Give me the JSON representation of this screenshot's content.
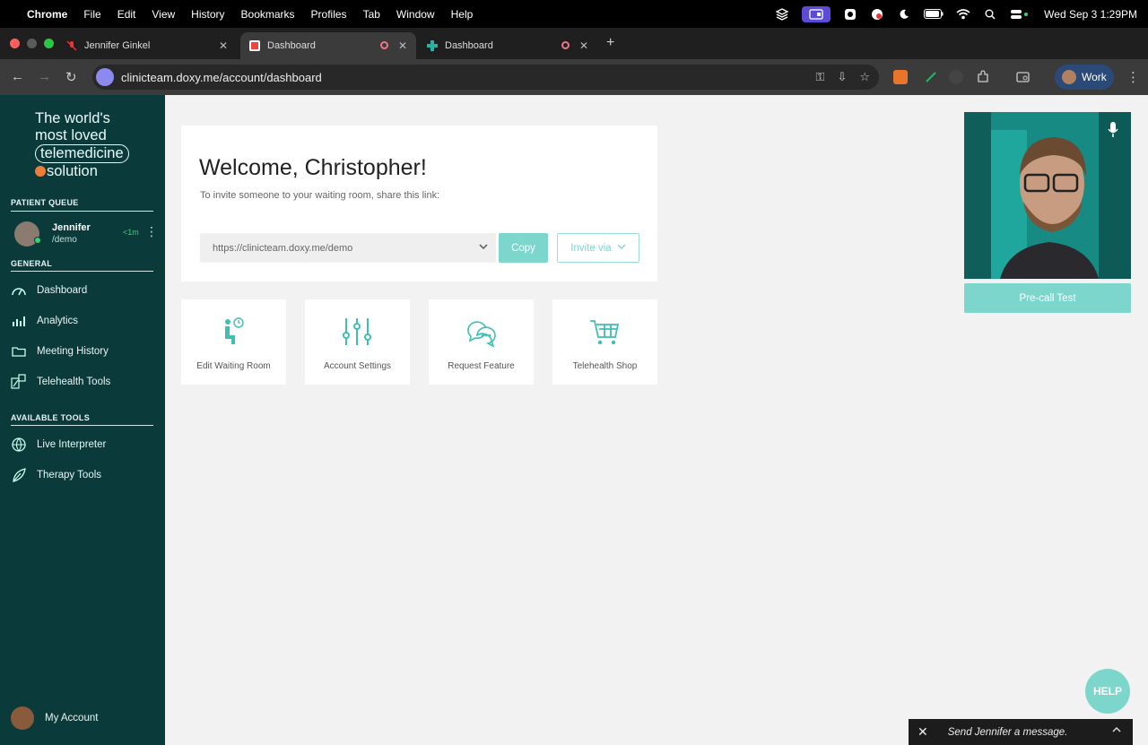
{
  "menubar": {
    "app": "Chrome",
    "items": [
      "File",
      "Edit",
      "View",
      "History",
      "Bookmarks",
      "Profiles",
      "Tab",
      "Window",
      "Help"
    ],
    "clock": "Wed Sep 3  1:29PM"
  },
  "tabs": [
    {
      "title": "Jennifer Ginkel"
    },
    {
      "title": "Dashboard"
    },
    {
      "title": "Dashboard"
    }
  ],
  "toolbar": {
    "url": "clinicteam.doxy.me/account/dashboard",
    "profile_label": "Work"
  },
  "sidebar": {
    "tagline": {
      "line1": "The world's",
      "line2": "most loved",
      "line3": "telemedicine",
      "line4": "solution"
    },
    "patient_queue_label": "PATIENT QUEUE",
    "queue": [
      {
        "name": "Jennifer",
        "room": "/demo",
        "wait": "<1m"
      }
    ],
    "general_label": "GENERAL",
    "general_items": [
      {
        "label": "Dashboard",
        "icon": "gauge-icon"
      },
      {
        "label": "Analytics",
        "icon": "analytics-icon"
      },
      {
        "label": "Meeting History",
        "icon": "folder-icon"
      },
      {
        "label": "Telehealth Tools",
        "icon": "tools-icon"
      }
    ],
    "available_tools_label": "AVAILABLE TOOLS",
    "tool_items": [
      {
        "label": "Live Interpreter",
        "icon": "globe-icon"
      },
      {
        "label": "Therapy Tools",
        "icon": "leaf-icon"
      }
    ],
    "my_account_label": "My Account"
  },
  "welcome": {
    "title": "Welcome, Christopher!",
    "subtitle": "To invite someone to your waiting room, share this link:",
    "link_value": "https://clinicteam.doxy.me/demo",
    "copy_label": "Copy",
    "invite_label": "Invite via"
  },
  "tiles": [
    {
      "label": "Edit Waiting Room",
      "icon": "waiting-room-icon"
    },
    {
      "label": "Account Settings",
      "icon": "sliders-icon"
    },
    {
      "label": "Request Feature",
      "icon": "chat-bubbles-icon"
    },
    {
      "label": "Telehealth Shop",
      "icon": "cart-icon"
    }
  ],
  "video": {
    "precall_label": "Pre-call Test"
  },
  "help_label": "HELP",
  "message_bar": {
    "placeholder": "Send Jennifer a message."
  },
  "colors": {
    "sidebar": "#0b3a3a",
    "accent": "#7dd6cc",
    "background": "#f2f2f2"
  }
}
